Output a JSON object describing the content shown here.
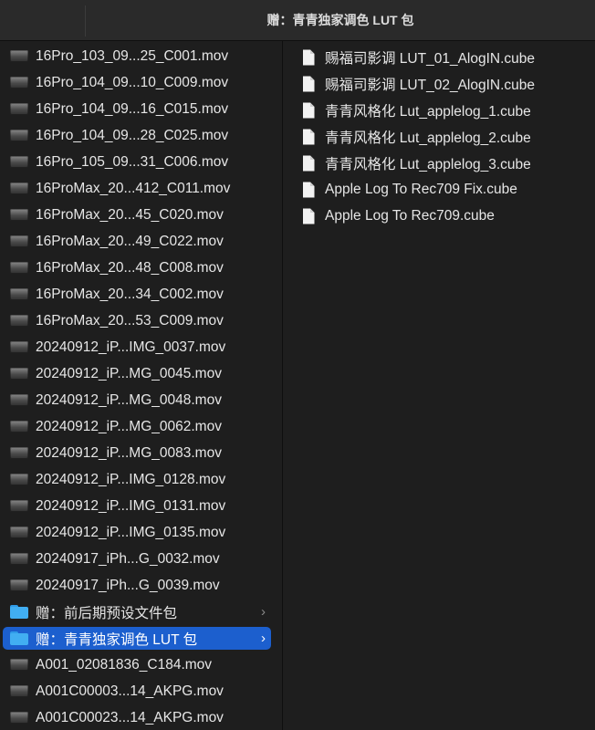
{
  "window": {
    "title": "赠：青青独家调色 LUT 包"
  },
  "left_column": {
    "items": [
      {
        "name": "16Pro_103_09...25_C001.mov",
        "kind": "video"
      },
      {
        "name": "16Pro_104_09...10_C009.mov",
        "kind": "video"
      },
      {
        "name": "16Pro_104_09...16_C015.mov",
        "kind": "video"
      },
      {
        "name": "16Pro_104_09...28_C025.mov",
        "kind": "video"
      },
      {
        "name": "16Pro_105_09...31_C006.mov",
        "kind": "video"
      },
      {
        "name": "16ProMax_20...412_C011.mov",
        "kind": "video"
      },
      {
        "name": "16ProMax_20...45_C020.mov",
        "kind": "video"
      },
      {
        "name": "16ProMax_20...49_C022.mov",
        "kind": "video"
      },
      {
        "name": "16ProMax_20...48_C008.mov",
        "kind": "video"
      },
      {
        "name": "16ProMax_20...34_C002.mov",
        "kind": "video"
      },
      {
        "name": "16ProMax_20...53_C009.mov",
        "kind": "video"
      },
      {
        "name": "20240912_iP...IMG_0037.mov",
        "kind": "video"
      },
      {
        "name": "20240912_iP...MG_0045.mov",
        "kind": "video"
      },
      {
        "name": "20240912_iP...MG_0048.mov",
        "kind": "video"
      },
      {
        "name": "20240912_iP...MG_0062.mov",
        "kind": "video"
      },
      {
        "name": "20240912_iP...MG_0083.mov",
        "kind": "video"
      },
      {
        "name": "20240912_iP...IMG_0128.mov",
        "kind": "video"
      },
      {
        "name": "20240912_iP...IMG_0131.mov",
        "kind": "video"
      },
      {
        "name": "20240912_iP...IMG_0135.mov",
        "kind": "video"
      },
      {
        "name": "20240917_iPh...G_0032.mov",
        "kind": "video"
      },
      {
        "name": "20240917_iPh...G_0039.mov",
        "kind": "video"
      },
      {
        "name": "赠：前后期预设文件包",
        "kind": "folder",
        "chevron": "›"
      },
      {
        "name": "赠：青青独家调色 LUT 包",
        "kind": "folder",
        "selected": true,
        "chevron": "›"
      },
      {
        "name": "A001_02081836_C184.mov",
        "kind": "video"
      },
      {
        "name": "A001C00003...14_AKPG.mov",
        "kind": "video"
      },
      {
        "name": "A001C00023...14_AKPG.mov",
        "kind": "video"
      }
    ]
  },
  "right_column": {
    "items": [
      {
        "name": "赐福司影调 LUT_01_AlogIN.cube",
        "kind": "document"
      },
      {
        "name": "赐福司影调 LUT_02_AlogIN.cube",
        "kind": "document"
      },
      {
        "name": "青青风格化 Lut_applelog_1.cube",
        "kind": "document"
      },
      {
        "name": "青青风格化 Lut_applelog_2.cube",
        "kind": "document"
      },
      {
        "name": "青青风格化 Lut_applelog_3.cube",
        "kind": "document"
      },
      {
        "name": "Apple Log To Rec709 Fix.cube",
        "kind": "document"
      },
      {
        "name": "Apple Log To Rec709.cube",
        "kind": "document"
      }
    ]
  },
  "colors": {
    "selection": "#1c5fce",
    "folder": "#41aef2",
    "background": "#1e1e1e"
  }
}
